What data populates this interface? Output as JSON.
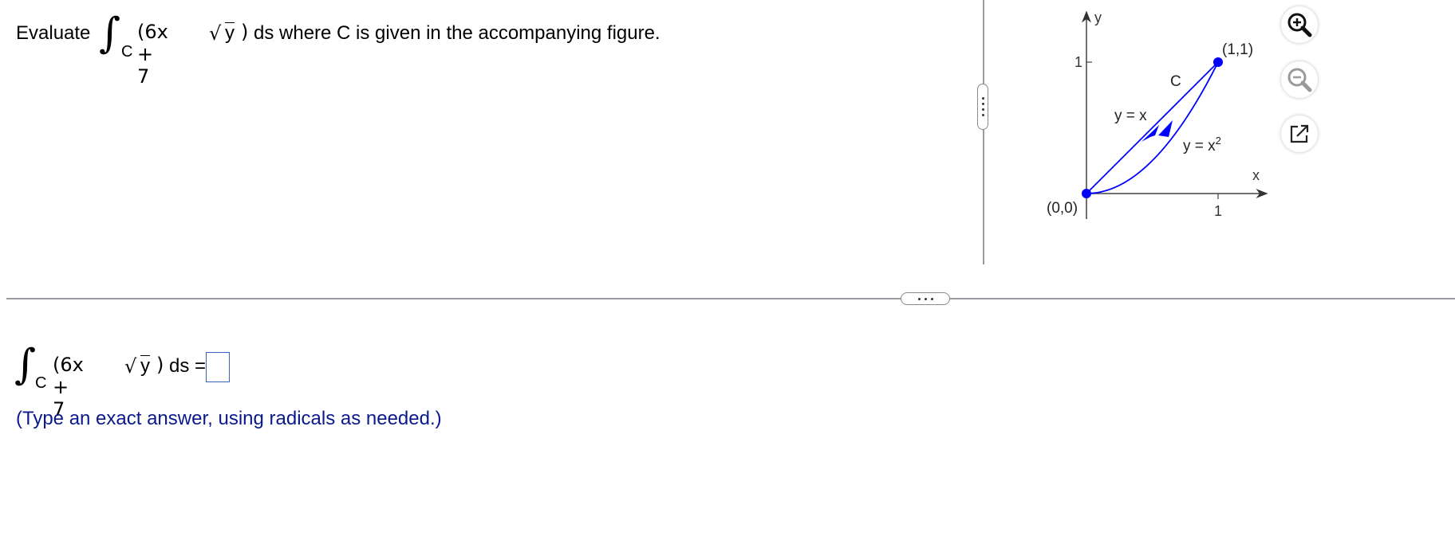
{
  "question": {
    "prefix": "Evaluate",
    "integral_sign": "∫",
    "subscript": "C",
    "integrand_open": "(6x + 7",
    "radical_sign": "√",
    "radicand": "y",
    "integrand_close": ")",
    "suffix": "ds where C is given in the accompanying figure."
  },
  "figure": {
    "axis_x": "x",
    "axis_y": "y",
    "tick_x": "1",
    "tick_y": "1",
    "origin_label": "(0,0)",
    "point_label": "(1,1)",
    "curve_label": "C",
    "line_label": "y = x",
    "parabola_label": "y = x",
    "parabola_exp": "2",
    "curve_color": "#0000ff"
  },
  "tools": {
    "zoom_in": "zoom-in-icon",
    "zoom_out": "zoom-out-icon",
    "popout": "popout-icon"
  },
  "answer": {
    "integral_sign": "∫",
    "subscript": "C",
    "integrand_open": "(6x + 7",
    "radical_sign": "√",
    "radicand": "y",
    "integrand_close": ")",
    "tail": "ds =",
    "value": "",
    "hint": "(Type an exact answer, using radicals as needed.)"
  }
}
